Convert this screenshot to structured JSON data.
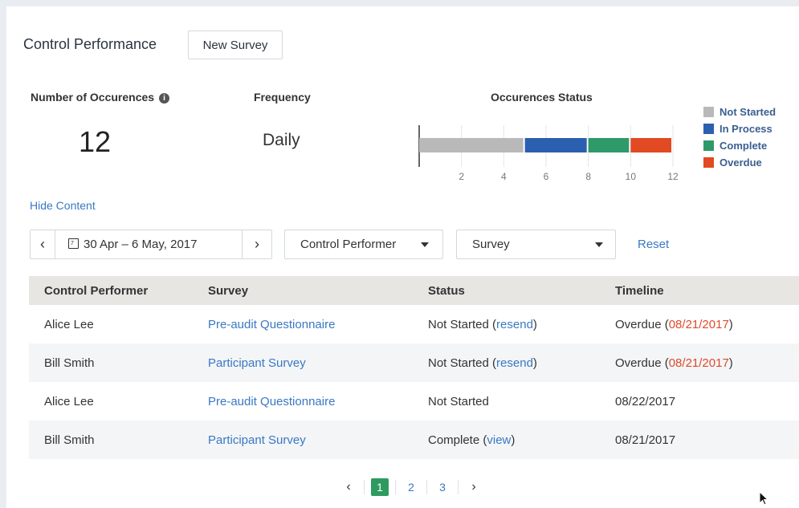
{
  "header": {
    "title": "Control Performance",
    "new_survey_label": "New Survey"
  },
  "stats": {
    "occurrences_label": "Number of Occurences",
    "occurrences_value": "12",
    "frequency_label": "Frequency",
    "frequency_value": "Daily",
    "status_label": "Occurences Status"
  },
  "chart_data": {
    "type": "bar",
    "orientation": "horizontal-stacked",
    "title": "Occurences Status",
    "xlim": [
      0,
      12
    ],
    "ticks": [
      "2",
      "4",
      "6",
      "8",
      "10",
      "12"
    ],
    "series": [
      {
        "name": "Not Started",
        "value": 5,
        "color": "#b9b9b9"
      },
      {
        "name": "In Process",
        "value": 3,
        "color": "#2b5fb0"
      },
      {
        "name": "Complete",
        "value": 2,
        "color": "#2e9a6a"
      },
      {
        "name": "Overdue",
        "value": 2,
        "color": "#e14a23"
      }
    ],
    "legend_position": "right"
  },
  "hide_content_label": "Hide Content",
  "filters": {
    "prev_icon": "chevron-left-icon",
    "next_icon": "chevron-right-icon",
    "calendar_icon": "calendar-icon",
    "date_range": "30 Apr – 6 May, 2017",
    "performer_select": "Control Performer",
    "survey_select": "Survey",
    "reset_label": "Reset"
  },
  "table": {
    "headers": [
      "Control Performer",
      "Survey",
      "Status",
      "Timeline"
    ],
    "rows": [
      {
        "performer": "Alice Lee",
        "survey": "Pre-audit Questionnaire",
        "status": "Not Started",
        "status_link": "resend",
        "timeline": "Overdue",
        "timeline_date": "08/21/2017"
      },
      {
        "performer": "Bill Smith",
        "survey": "Participant Survey",
        "status": "Not Started",
        "status_link": "resend",
        "timeline": "Overdue",
        "timeline_date": "08/21/2017"
      },
      {
        "performer": "Alice Lee",
        "survey": "Pre-audit Questionnaire",
        "status": "Not Started",
        "status_link": "",
        "timeline": "08/22/2017",
        "timeline_date": ""
      },
      {
        "performer": "Bill Smith",
        "survey": "Participant Survey",
        "status": "Complete",
        "status_link": "view",
        "timeline": "08/21/2017",
        "timeline_date": ""
      }
    ]
  },
  "pagination": {
    "pages": [
      "1",
      "2",
      "3"
    ],
    "current": "1",
    "prev": "‹",
    "next": "›"
  }
}
